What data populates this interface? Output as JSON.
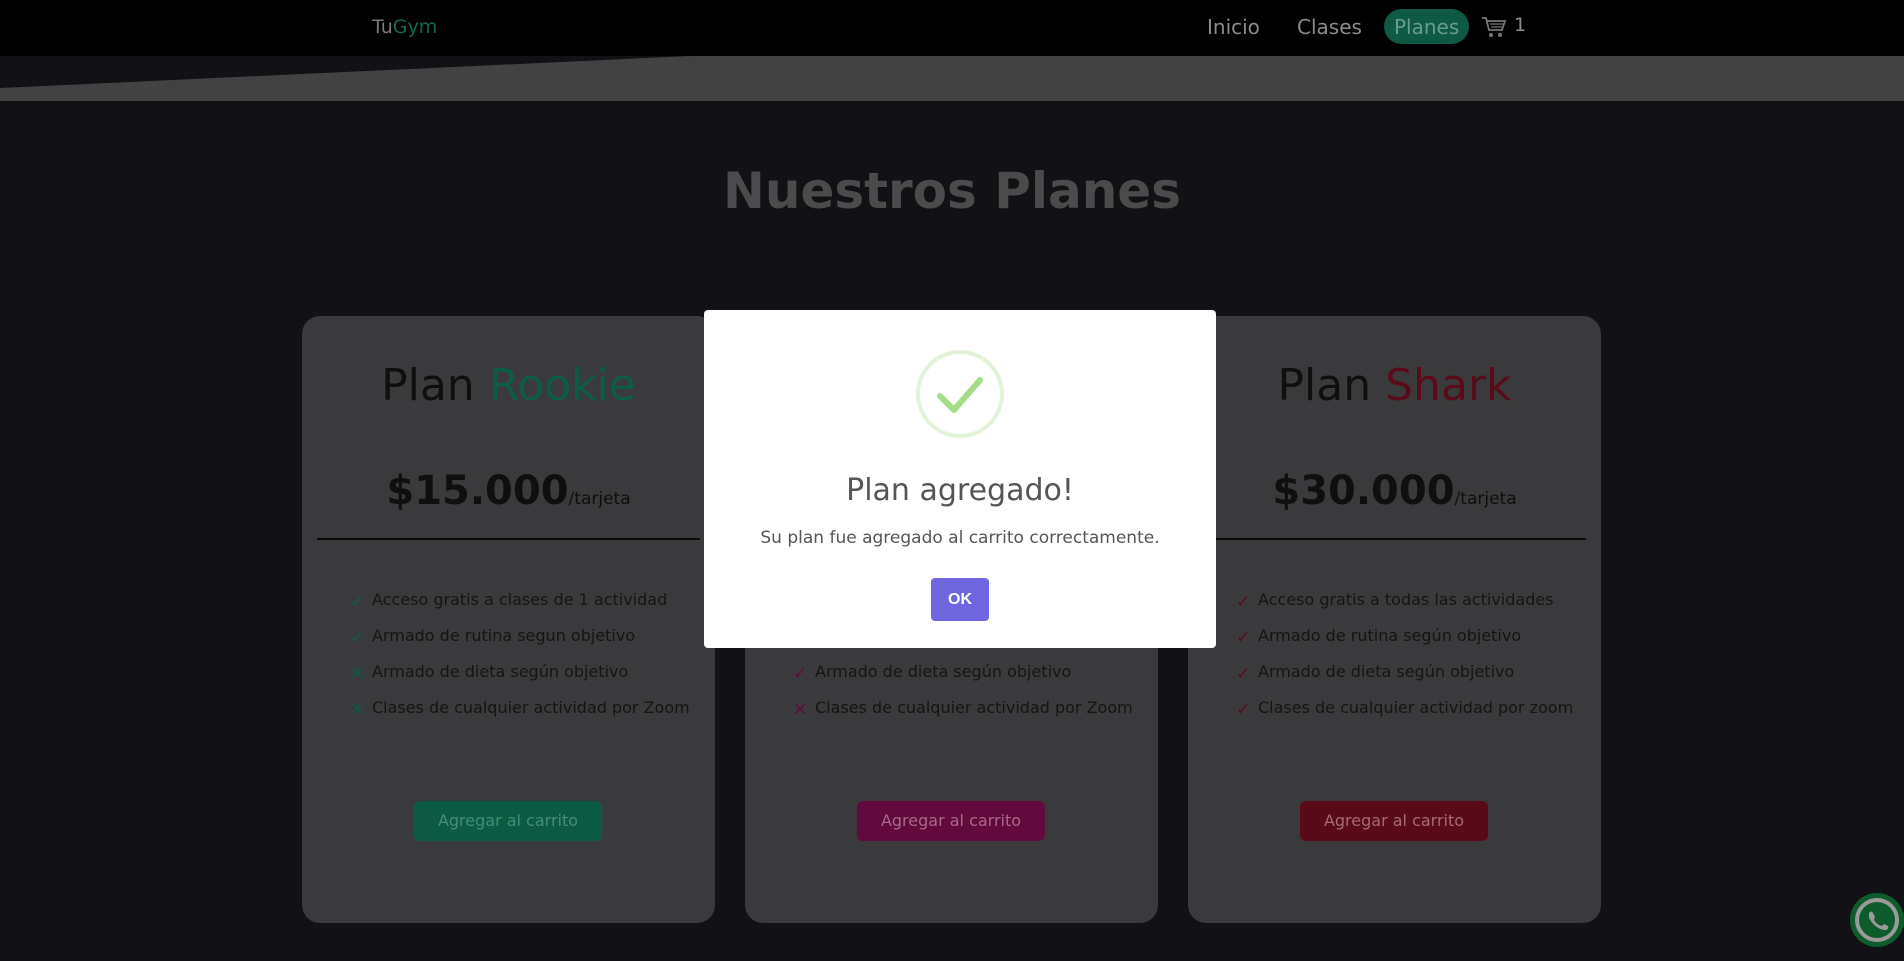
{
  "navbar": {
    "brand_prefix": "Tu",
    "brand_accent": "Gym",
    "links": [
      {
        "label": "Inicio"
      },
      {
        "label": "Clases"
      },
      {
        "label": "Planes"
      }
    ],
    "cart_icon": "cart-icon",
    "cart_count": "1"
  },
  "page_title": "Nuestros Planes",
  "cards": [
    {
      "plan_word": "Plan",
      "name": "Rookie",
      "price": "$15.000",
      "per": "/tarjeta",
      "features": [
        {
          "icon": "check-icon",
          "text": "Acceso gratis a clases de 1 actividad"
        },
        {
          "icon": "check-icon",
          "text": "Armado de rutina segun objetivo"
        },
        {
          "icon": "cross-icon",
          "text": "Armado de dieta según objetivo"
        },
        {
          "icon": "cross-icon",
          "text": "Clases de cualquier actividad por Zoom"
        }
      ],
      "button": "Agregar al carrito"
    },
    {
      "features_visible": [
        {
          "icon": "check-icon",
          "text": "Armado de dieta según objetivo"
        },
        {
          "icon": "cross-icon",
          "text": "Clases de cualquier actividad por Zoom"
        }
      ],
      "button": "Agregar al carrito"
    },
    {
      "plan_word": "Plan",
      "name": "Shark",
      "price": "$30.000",
      "per": "/tarjeta",
      "features": [
        {
          "icon": "check-icon",
          "text": "Acceso gratis a todas las actividades"
        },
        {
          "icon": "check-icon",
          "text": "Armado de rutina según objetivo"
        },
        {
          "icon": "check-icon",
          "text": "Armado de dieta según objetivo"
        },
        {
          "icon": "check-icon",
          "text": "Clases de cualquier actividad por zoom"
        }
      ],
      "button": "Agregar al carrito"
    }
  ],
  "modal": {
    "icon": "success-check-icon",
    "title": "Plan agregado!",
    "text": "Su plan fue agregado al carrito correctamente.",
    "ok": "OK"
  },
  "whatsapp_icon": "whatsapp-icon",
  "colors": {
    "rookie": "#1fb28a",
    "medium": "#c2127a",
    "shark": "#dc1545",
    "ok_button": "#7066e0"
  }
}
